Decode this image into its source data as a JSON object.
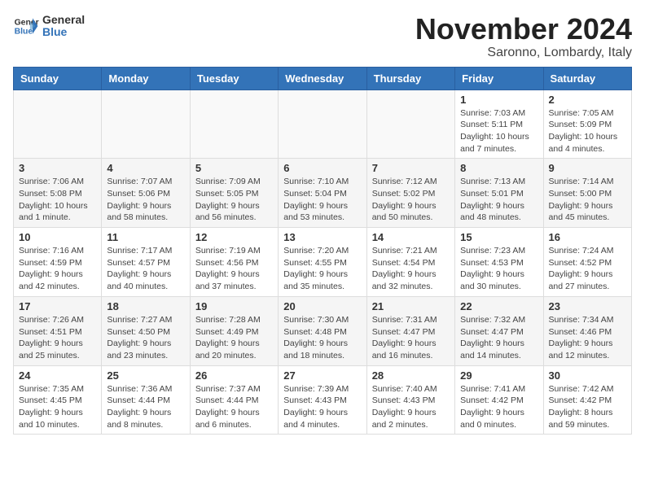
{
  "header": {
    "logo_line1": "General",
    "logo_line2": "Blue",
    "month_title": "November 2024",
    "subtitle": "Saronno, Lombardy, Italy"
  },
  "days_of_week": [
    "Sunday",
    "Monday",
    "Tuesday",
    "Wednesday",
    "Thursday",
    "Friday",
    "Saturday"
  ],
  "weeks": [
    {
      "shaded": false,
      "days": [
        {
          "num": "",
          "info": ""
        },
        {
          "num": "",
          "info": ""
        },
        {
          "num": "",
          "info": ""
        },
        {
          "num": "",
          "info": ""
        },
        {
          "num": "",
          "info": ""
        },
        {
          "num": "1",
          "info": "Sunrise: 7:03 AM\nSunset: 5:11 PM\nDaylight: 10 hours and 7 minutes."
        },
        {
          "num": "2",
          "info": "Sunrise: 7:05 AM\nSunset: 5:09 PM\nDaylight: 10 hours and 4 minutes."
        }
      ]
    },
    {
      "shaded": true,
      "days": [
        {
          "num": "3",
          "info": "Sunrise: 7:06 AM\nSunset: 5:08 PM\nDaylight: 10 hours and 1 minute."
        },
        {
          "num": "4",
          "info": "Sunrise: 7:07 AM\nSunset: 5:06 PM\nDaylight: 9 hours and 58 minutes."
        },
        {
          "num": "5",
          "info": "Sunrise: 7:09 AM\nSunset: 5:05 PM\nDaylight: 9 hours and 56 minutes."
        },
        {
          "num": "6",
          "info": "Sunrise: 7:10 AM\nSunset: 5:04 PM\nDaylight: 9 hours and 53 minutes."
        },
        {
          "num": "7",
          "info": "Sunrise: 7:12 AM\nSunset: 5:02 PM\nDaylight: 9 hours and 50 minutes."
        },
        {
          "num": "8",
          "info": "Sunrise: 7:13 AM\nSunset: 5:01 PM\nDaylight: 9 hours and 48 minutes."
        },
        {
          "num": "9",
          "info": "Sunrise: 7:14 AM\nSunset: 5:00 PM\nDaylight: 9 hours and 45 minutes."
        }
      ]
    },
    {
      "shaded": false,
      "days": [
        {
          "num": "10",
          "info": "Sunrise: 7:16 AM\nSunset: 4:59 PM\nDaylight: 9 hours and 42 minutes."
        },
        {
          "num": "11",
          "info": "Sunrise: 7:17 AM\nSunset: 4:57 PM\nDaylight: 9 hours and 40 minutes."
        },
        {
          "num": "12",
          "info": "Sunrise: 7:19 AM\nSunset: 4:56 PM\nDaylight: 9 hours and 37 minutes."
        },
        {
          "num": "13",
          "info": "Sunrise: 7:20 AM\nSunset: 4:55 PM\nDaylight: 9 hours and 35 minutes."
        },
        {
          "num": "14",
          "info": "Sunrise: 7:21 AM\nSunset: 4:54 PM\nDaylight: 9 hours and 32 minutes."
        },
        {
          "num": "15",
          "info": "Sunrise: 7:23 AM\nSunset: 4:53 PM\nDaylight: 9 hours and 30 minutes."
        },
        {
          "num": "16",
          "info": "Sunrise: 7:24 AM\nSunset: 4:52 PM\nDaylight: 9 hours and 27 minutes."
        }
      ]
    },
    {
      "shaded": true,
      "days": [
        {
          "num": "17",
          "info": "Sunrise: 7:26 AM\nSunset: 4:51 PM\nDaylight: 9 hours and 25 minutes."
        },
        {
          "num": "18",
          "info": "Sunrise: 7:27 AM\nSunset: 4:50 PM\nDaylight: 9 hours and 23 minutes."
        },
        {
          "num": "19",
          "info": "Sunrise: 7:28 AM\nSunset: 4:49 PM\nDaylight: 9 hours and 20 minutes."
        },
        {
          "num": "20",
          "info": "Sunrise: 7:30 AM\nSunset: 4:48 PM\nDaylight: 9 hours and 18 minutes."
        },
        {
          "num": "21",
          "info": "Sunrise: 7:31 AM\nSunset: 4:47 PM\nDaylight: 9 hours and 16 minutes."
        },
        {
          "num": "22",
          "info": "Sunrise: 7:32 AM\nSunset: 4:47 PM\nDaylight: 9 hours and 14 minutes."
        },
        {
          "num": "23",
          "info": "Sunrise: 7:34 AM\nSunset: 4:46 PM\nDaylight: 9 hours and 12 minutes."
        }
      ]
    },
    {
      "shaded": false,
      "days": [
        {
          "num": "24",
          "info": "Sunrise: 7:35 AM\nSunset: 4:45 PM\nDaylight: 9 hours and 10 minutes."
        },
        {
          "num": "25",
          "info": "Sunrise: 7:36 AM\nSunset: 4:44 PM\nDaylight: 9 hours and 8 minutes."
        },
        {
          "num": "26",
          "info": "Sunrise: 7:37 AM\nSunset: 4:44 PM\nDaylight: 9 hours and 6 minutes."
        },
        {
          "num": "27",
          "info": "Sunrise: 7:39 AM\nSunset: 4:43 PM\nDaylight: 9 hours and 4 minutes."
        },
        {
          "num": "28",
          "info": "Sunrise: 7:40 AM\nSunset: 4:43 PM\nDaylight: 9 hours and 2 minutes."
        },
        {
          "num": "29",
          "info": "Sunrise: 7:41 AM\nSunset: 4:42 PM\nDaylight: 9 hours and 0 minutes."
        },
        {
          "num": "30",
          "info": "Sunrise: 7:42 AM\nSunset: 4:42 PM\nDaylight: 8 hours and 59 minutes."
        }
      ]
    }
  ]
}
